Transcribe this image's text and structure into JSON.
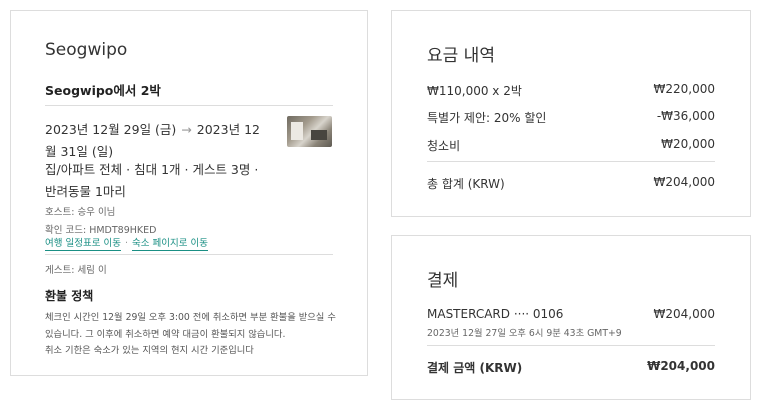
{
  "reservation": {
    "city": "Seogwipo",
    "trip_title": "Seogwipo에서 2박",
    "date_range": "2023년 12월 29일 (금) → 2023년 12월 31일 (일)",
    "checkin_date": "2023년 12월 29일 (금)",
    "arrow": "→",
    "checkout_date": "2023년 12월 31일 (일)",
    "details": "집/아파트 전체 · 침대 1개 · 게스트 3명 · 반려동물 1마리",
    "host": "호스트: 승우 이님",
    "confirmation": "확인 코드: HMDT89HKED",
    "link_itinerary": "여행 일정표로 이동",
    "link_separator": "·",
    "link_listing": "숙소 페이지로 이동",
    "guest": "게스트: 세림 이"
  },
  "refund": {
    "title": "환불 정책",
    "body": "체크인 시간인 12월 29일 오후 3:00 전에 취소하면 부분 환불을 받으실 수 있습니다. 그 이후에 취소하면 예약 대금이 환불되지 않습니다.",
    "note": "취소 기한은 숙소가 있는 지역의 현지 시간 기준입니다"
  },
  "summary": {
    "title": "요금 내역",
    "rows": [
      {
        "label": "₩110,000 x 2박",
        "value": "₩220,000"
      },
      {
        "label": "특별가 제안: 20% 할인",
        "value": "-₩36,000"
      },
      {
        "label": "청소비",
        "value": "₩20,000"
      }
    ],
    "total_label": "총 합계 (KRW)",
    "total_value": "₩204,000"
  },
  "payment": {
    "title": "결제",
    "card_label": "MASTERCARD ···· 0106",
    "card_amount": "₩204,000",
    "timestamp": "2023년 12월 27일 오후 6시 9분 43초 GMT+9",
    "total_label": "결제 금액 (KRW)",
    "total_value": "₩204,000"
  },
  "colors": {
    "link": "#1a8f84",
    "divider": "#dddddd",
    "text": "#222222"
  }
}
